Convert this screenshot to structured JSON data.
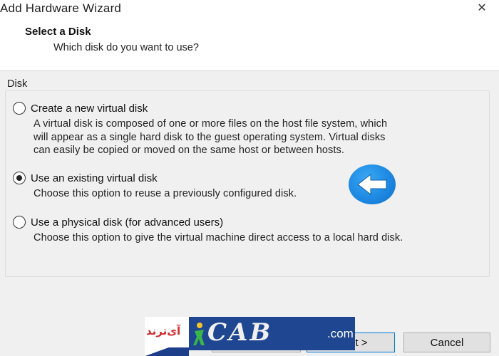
{
  "window": {
    "title": "Add Hardware Wizard",
    "close_glyph": "✕"
  },
  "header": {
    "title": "Select a Disk",
    "subtitle": "Which disk do you want to use?"
  },
  "group": {
    "label": "Disk"
  },
  "options": [
    {
      "label": "Create a new virtual disk",
      "description": "A virtual disk is composed of one or more files on the host file system, which\nwill appear as a single hard disk to the guest operating system. Virtual disks\ncan easily be copied or moved on the same host or between hosts.",
      "checked": false
    },
    {
      "label": "Use an existing virtual disk",
      "description": "Choose this option to reuse a previously configured disk.",
      "checked": true
    },
    {
      "label": "Use a physical disk (for advanced users)",
      "description": "Choose this option to give the virtual machine direct access to a local hard disk.",
      "checked": false
    }
  ],
  "annotation": {
    "icon": "arrow-left-icon",
    "color": "#1c86e0"
  },
  "buttons": {
    "next": "t >",
    "cancel": "Cancel"
  },
  "watermark": {
    "persian": "آی‌ترند",
    "logo": "CAB",
    "logo_suffix": ".com"
  }
}
